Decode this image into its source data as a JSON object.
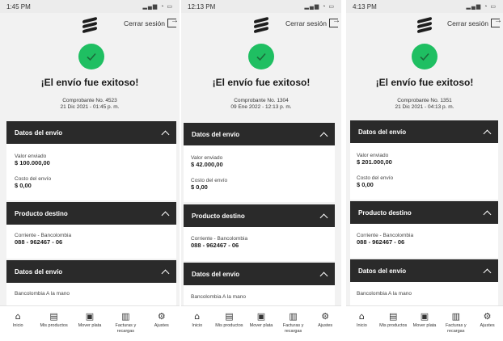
{
  "colors": {
    "success_green": "#1fbf62",
    "section_header_bg": "#2a2a2a",
    "background": "#f2f2f2"
  },
  "common": {
    "logout_label": "Cerrar sesión",
    "success_title": "¡El envío fue exitoso!",
    "section_envio": "Datos del envío",
    "label_valor": "Valor enviado",
    "label_costo": "Costo del envío",
    "section_producto": "Producto destino",
    "product_name": "Corriente - Bancolombia",
    "product_number": "088 - 962467 - 06",
    "section_envio_2": "Datos del envío",
    "channel": "Bancolombia A la mano",
    "nav": [
      {
        "icon": "home-icon",
        "label": "Inicio"
      },
      {
        "icon": "products-icon",
        "label": "Mis productos"
      },
      {
        "icon": "money-icon",
        "label": "Mover plata"
      },
      {
        "icon": "bills-icon",
        "label": "Facturas y recargas"
      },
      {
        "icon": "settings-icon",
        "label": "Ajustes"
      }
    ]
  },
  "screens": [
    {
      "time": "1:45 PM",
      "receipt": "Comprobante No. 4523",
      "datetime": "21 Dic 2021 - 01:45 p. m.",
      "valor": "$ 100.000,00",
      "costo": "$ 0,00"
    },
    {
      "time": "12:13 PM",
      "receipt": "Comprobante No. 1304",
      "datetime": "09 Ene 2022 - 12:13 p. m.",
      "valor": "$ 42.000,00",
      "costo": "$ 0,00"
    },
    {
      "time": "4:13 PM",
      "receipt": "Comprobante No. 1351",
      "datetime": "21 Dic 2021 - 04:13 p. m.",
      "valor": "$ 201.000,00",
      "costo": "$ 0,00"
    }
  ]
}
